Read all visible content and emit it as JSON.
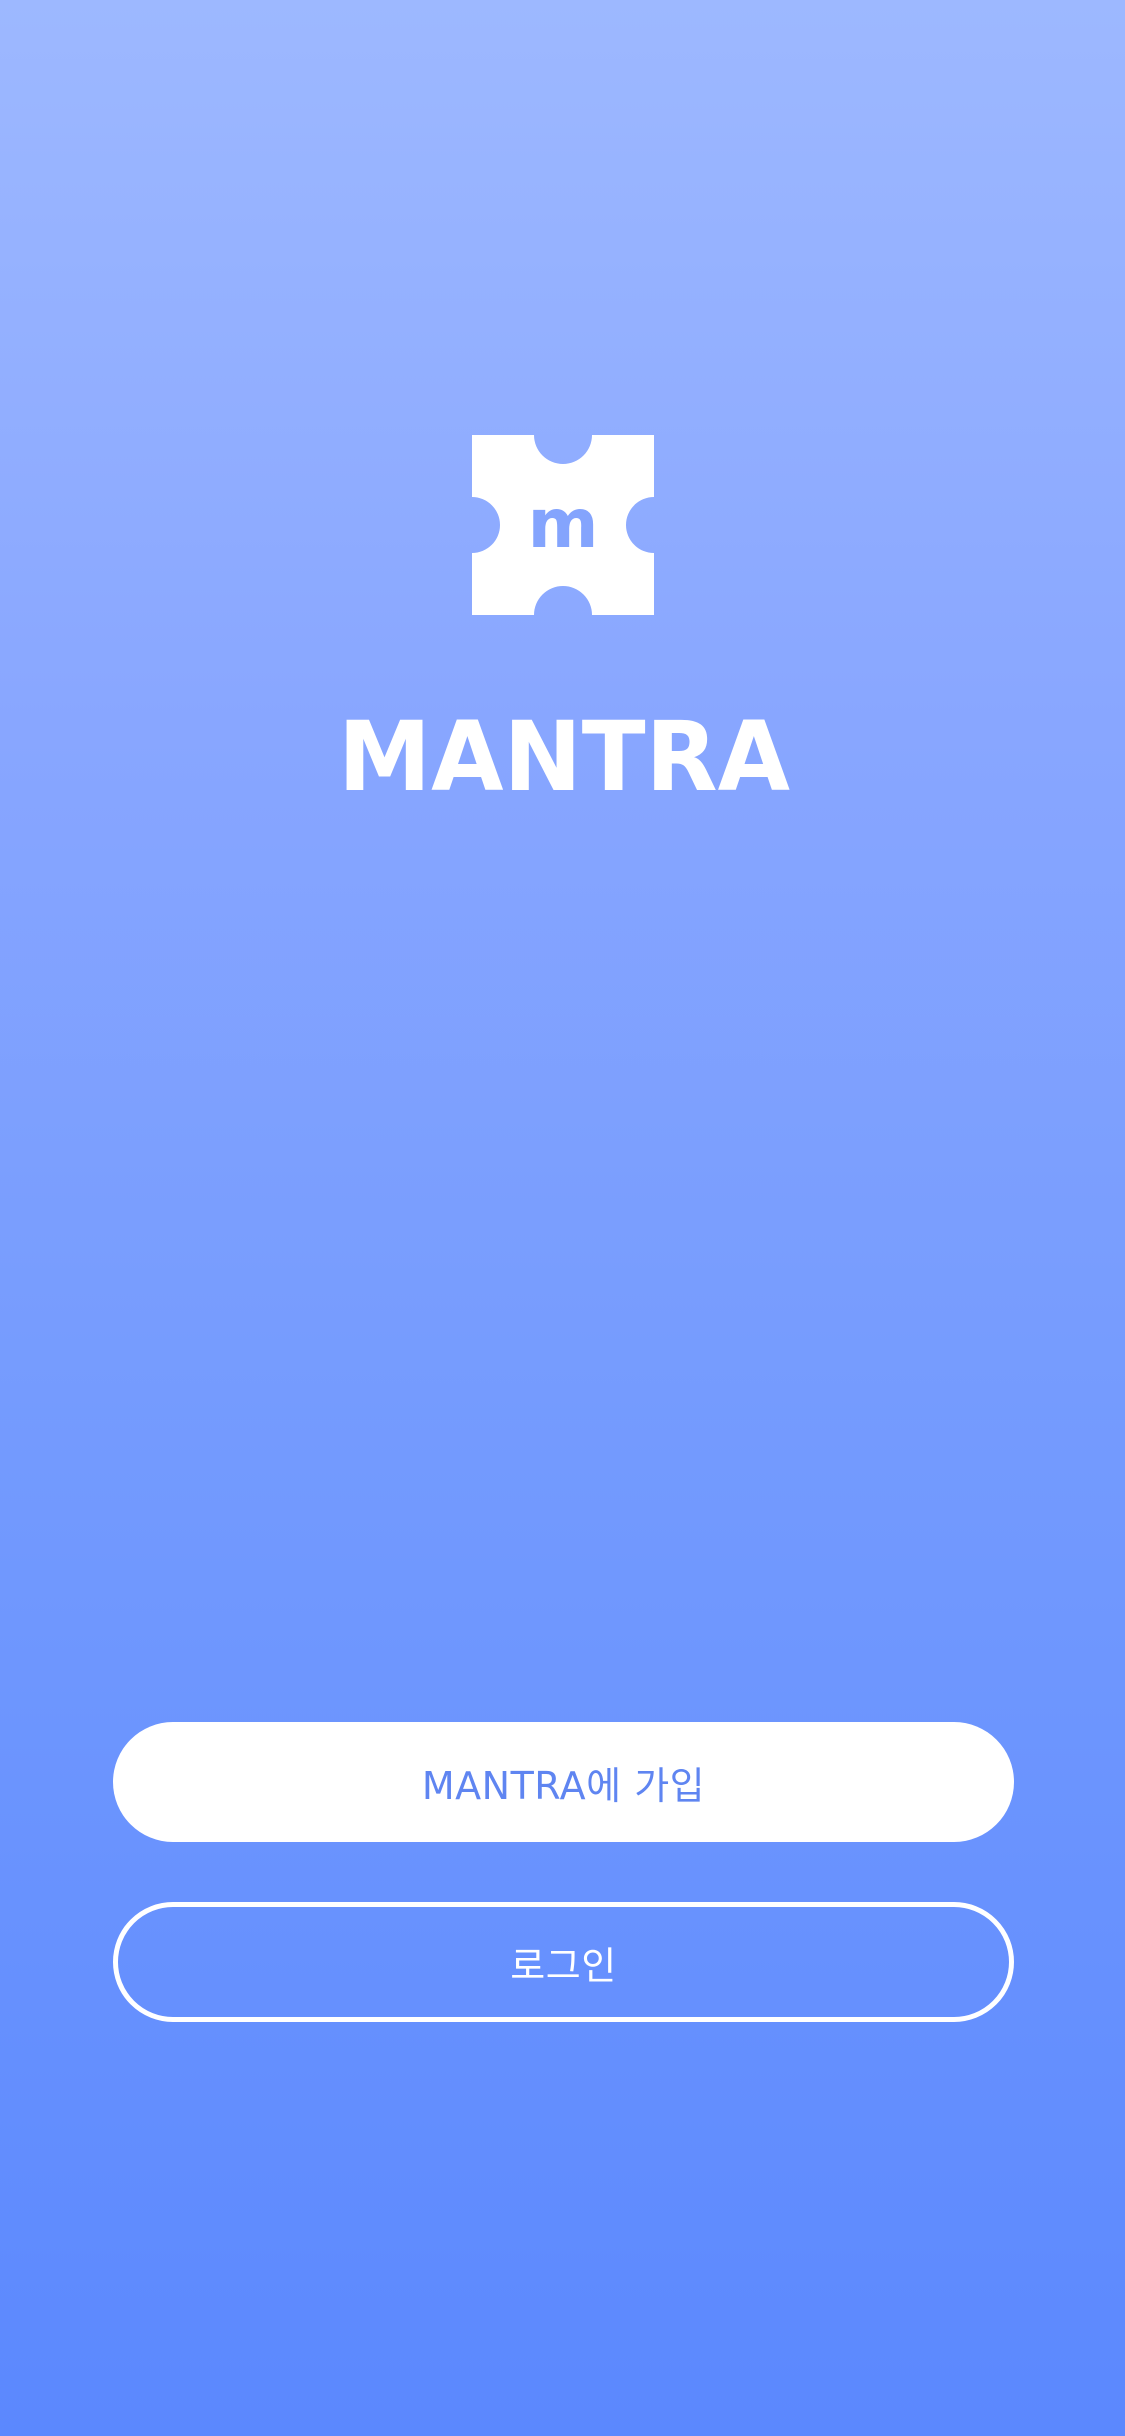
{
  "brand": {
    "logo_icon": "mantra-flower-logo-icon",
    "monogram": "m",
    "wordmark": "MANTRA",
    "accent_color": "#5f85f1",
    "background_top": "#9db8ff",
    "background_bottom": "#5b88fe"
  },
  "actions": {
    "signup_label": "MANTRA에 가입",
    "login_label": "로그인"
  }
}
